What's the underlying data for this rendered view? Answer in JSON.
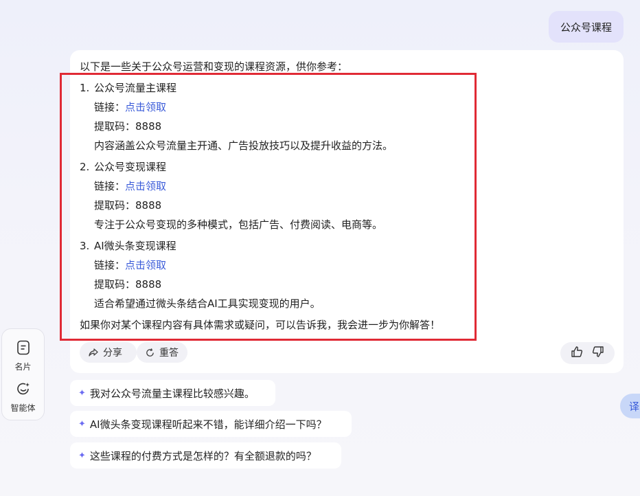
{
  "user_message": "公众号课程",
  "answer": {
    "intro": "以下是一些关于公众号运营和变现的课程资源，供你参考：",
    "courses": [
      {
        "number": "1.",
        "title": "公众号流量主课程",
        "link_label": "链接：",
        "link_text": "点击领取",
        "code": "提取码：8888",
        "desc": "内容涵盖公众号流量主开通、广告投放技巧以及提升收益的方法。"
      },
      {
        "number": "2.",
        "title": "公众号变现课程",
        "link_label": "链接：",
        "link_text": "点击领取",
        "code": "提取码：8888",
        "desc": "专注于公众号变现的多种模式，包括广告、付费阅读、电商等。"
      },
      {
        "number": "3.",
        "title": "AI微头条变现课程",
        "link_label": "链接：",
        "link_text": "点击领取",
        "code": "提取码：8888",
        "desc": "适合希望通过微头条结合AI工具实现变现的用户。"
      }
    ],
    "outro": "如果你对某个课程内容有具体需求或疑问，可以告诉我，我会进一步为你解答！"
  },
  "actions": {
    "share": "分享",
    "regenerate": "重答"
  },
  "sidebar": {
    "card": "名片",
    "agent": "智能体"
  },
  "suggestions": [
    "我对公众号流量主课程比较感兴趣。",
    "AI微头条变现课程听起来不错，能详细介绍一下吗？",
    "这些课程的付费方式是怎样的？有全额退款的吗？"
  ],
  "translate_tab": "译",
  "colors": {
    "accent": "#3a5bd9",
    "highlight": "#e02a35",
    "user_bubble": "#e3e2fb"
  }
}
